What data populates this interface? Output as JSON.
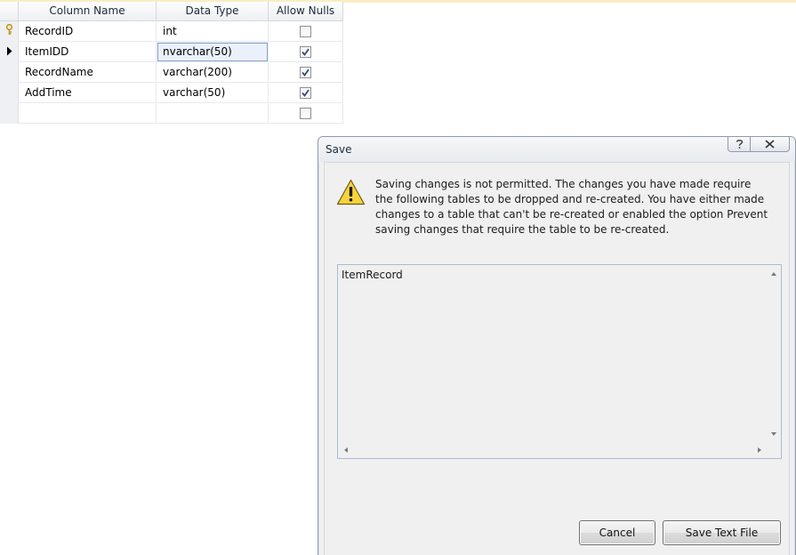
{
  "grid": {
    "columns": [
      "Column Name",
      "Data Type",
      "Allow Nulls"
    ],
    "rows": [
      {
        "name": "RecordID",
        "type": "int",
        "allow_nulls": false,
        "indicator": "primary-key-icon"
      },
      {
        "name": "ItemIDD",
        "type": "nvarchar(50)",
        "allow_nulls": true,
        "indicator": "current-row-arrow-icon",
        "active_cell": "type"
      },
      {
        "name": "RecordName",
        "type": "varchar(200)",
        "allow_nulls": true,
        "indicator": ""
      },
      {
        "name": "AddTime",
        "type": "varchar(50)",
        "allow_nulls": true,
        "indicator": ""
      },
      {
        "name": "",
        "type": "",
        "allow_nulls": false,
        "indicator": ""
      }
    ]
  },
  "dialog": {
    "title": "Save",
    "help_icon": "help-icon",
    "close_icon": "close-icon",
    "warning_icon": "warning-icon",
    "message": "Saving changes is not permitted. The changes you have made require the following tables to be dropped and re-created. You have either made changes to a table that can't be re-created or enabled the option Prevent saving changes that require the table to be re-created.",
    "tables_text": "ItemRecord",
    "buttons": {
      "cancel": "Cancel",
      "save_text_file": "Save Text File"
    }
  },
  "colors": {
    "warning_fill": "#f7d33b",
    "dialog_border": "#8f9aab",
    "key_icon": "#d4a017"
  }
}
